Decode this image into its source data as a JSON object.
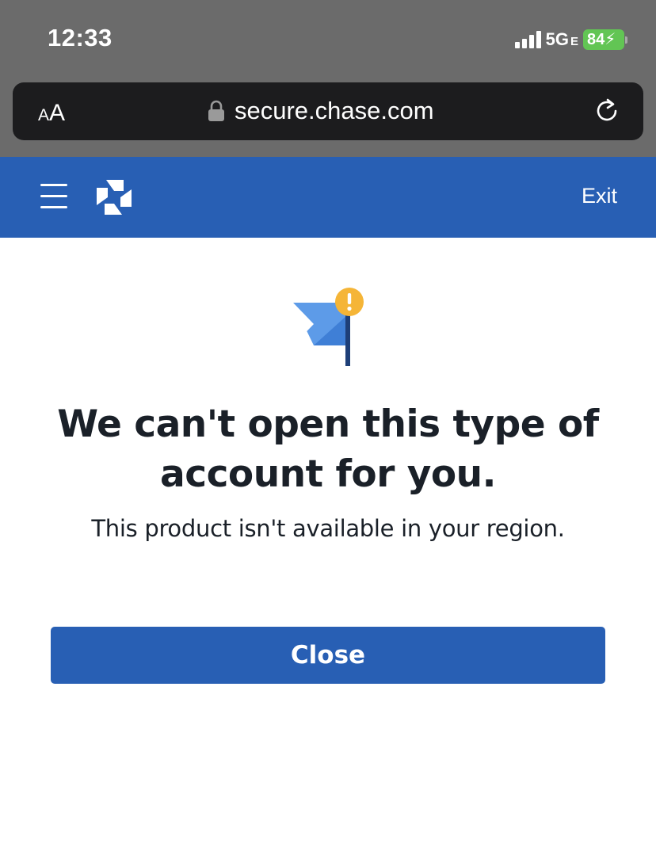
{
  "status_bar": {
    "time": "12:33",
    "network": "5G",
    "network_suffix": "E",
    "battery": "84"
  },
  "browser": {
    "text_size_small": "A",
    "text_size_big": "A",
    "url": "secure.chase.com",
    "icons": [
      "lock-icon",
      "reload-icon"
    ]
  },
  "header": {
    "exit_label": "Exit",
    "icons": [
      "menu-icon",
      "chase-logo"
    ],
    "background": "#285fb4"
  },
  "main": {
    "icon": "flag-warning-icon",
    "heading": "We can't open this type of account for you.",
    "message": "This product isn't available in your region.",
    "close_label": "Close",
    "accent": "#285fb4",
    "warning": "#f5b537"
  }
}
